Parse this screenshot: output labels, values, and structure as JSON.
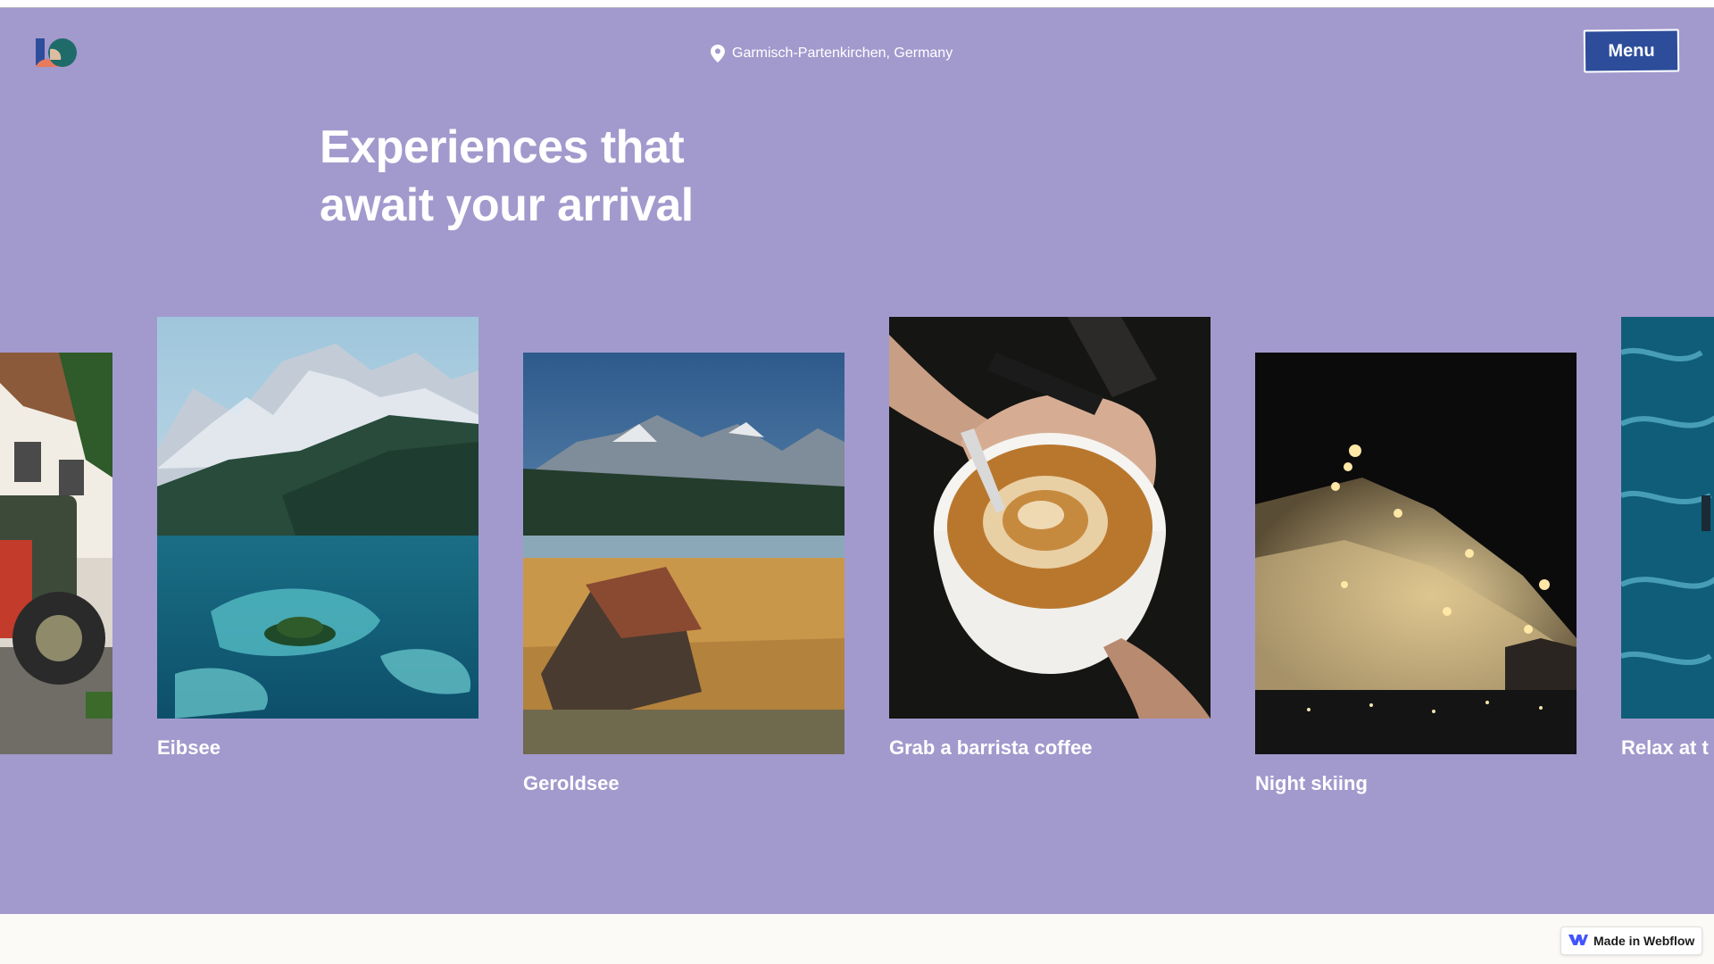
{
  "header": {
    "location": "Garmisch-Partenkirchen, Germany",
    "menu_label": "Menu"
  },
  "hero": {
    "headline_line1": "Experiences that",
    "headline_line2": "await your arrival"
  },
  "experiences": [
    {
      "title": ""
    },
    {
      "title": "Eibsee"
    },
    {
      "title": "Geroldsee"
    },
    {
      "title": "Grab a barrista coffee"
    },
    {
      "title": "Night skiing"
    },
    {
      "title": "Relax at t"
    }
  ],
  "badge": {
    "label": "Made in Webflow"
  },
  "colors": {
    "hero_background": "#a29acd",
    "menu_button": "#2d4d9b",
    "text": "#ffffff"
  }
}
